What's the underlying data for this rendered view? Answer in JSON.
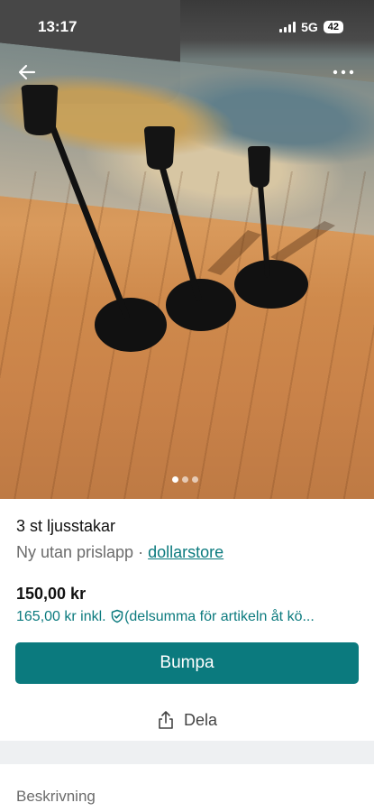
{
  "status_bar": {
    "time": "13:17",
    "network": "5G",
    "battery": "42"
  },
  "gallery": {
    "image_alt": "Three black candle holders on a wooden floor",
    "page_count": 3,
    "active_index": 0
  },
  "listing": {
    "title": "3 st ljusstakar",
    "condition": "Ny utan prislapp",
    "separator": "·",
    "brand": "dollarstore",
    "price": "150,00 kr",
    "price_incl_prefix": "165,00 kr inkl.",
    "price_incl_suffix": "(delsumma för artikeln åt kö..."
  },
  "actions": {
    "bump_label": "Bumpa",
    "share_label": "Dela"
  },
  "sections": {
    "description_label": "Beskrivning"
  },
  "colors": {
    "accent": "#0b7a7e"
  }
}
